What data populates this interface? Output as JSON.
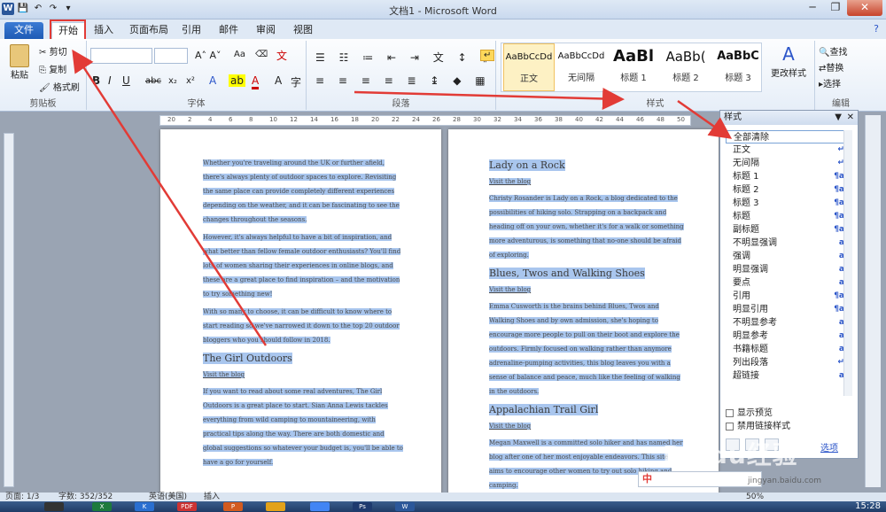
{
  "window": {
    "title": "文档1 - Microsoft Word",
    "qat_icons": [
      "word-logo",
      "save-icon",
      "undo-icon",
      "redo-icon",
      "customize-icon"
    ]
  },
  "tabs": [
    "文件",
    "开始",
    "插入",
    "页面布局",
    "引用",
    "邮件",
    "审阅",
    "视图"
  ],
  "active_tab": "开始",
  "ribbon": {
    "clipboard": {
      "label": "剪贴板",
      "paste": "粘贴",
      "cut": "剪切",
      "copy": "复制",
      "format_painter": "格式刷"
    },
    "font": {
      "label": "字体",
      "buttons": [
        "B",
        "I",
        "U",
        "abc",
        "x₂",
        "x²",
        "A",
        "Aa"
      ]
    },
    "paragraph": {
      "label": "段落"
    },
    "styles": {
      "label": "样式",
      "items": [
        {
          "preview": "AaBbCcDd",
          "name": "正文"
        },
        {
          "preview": "AaBbCcDd",
          "name": "无间隔"
        },
        {
          "preview": "AaBl",
          "name": "标题 1"
        },
        {
          "preview": "AaBb(",
          "name": "标题 2"
        },
        {
          "preview": "AaBbC",
          "name": "标题 3"
        }
      ],
      "change_styles": "更改样式"
    },
    "editing": {
      "label": "编辑",
      "find": "查找",
      "replace": "替换",
      "select": "选择"
    }
  },
  "ruler": {
    "ticks": [
      "20",
      "2",
      "4",
      "6",
      "8",
      "10",
      "12",
      "14",
      "16",
      "18",
      "20",
      "22",
      "24",
      "26",
      "28",
      "30",
      "32",
      "34",
      "36",
      "38",
      "40",
      "42",
      "44",
      "46",
      "48",
      "50"
    ]
  },
  "page1": {
    "paragraphs": [
      "Whether you're traveling around the UK or further afield, there's always plenty of outdoor spaces to explore. Revisiting the same place can provide completely different experiences depending on the weather, and it can be fascinating to see the changes throughout the seasons.",
      "However, it's always helpful to have a bit of inspiration, and what better than fellow female outdoor enthusiasts? You'll find lots of women sharing their experiences in online blogs, and these are a great place to find inspiration – and the motivation to try something new!",
      "With so many to choose, it can be difficult to know where to start reading so we've narrowed it down to the top 20 outdoor bloggers who you should follow in 2018."
    ],
    "heading": "The Girl Outdoors",
    "link": "Visit the blog",
    "para_after": "If you want to read about some real adventures, The Girl Outdoors is a great place to start. Sian Anna Lewis tackles everything from wild camping to mountaineering, with practical tips along the way. There are both domestic and global suggestions so whatever your budget is, you'll be able to have a go for yourself."
  },
  "page2": {
    "sections": [
      {
        "heading": "Lady on a Rock",
        "link": "Visit the blog",
        "text": "Christy Rosander is Lady on a Rock, a blog dedicated to the possibilities of hiking solo. Strapping on a backpack and heading off on your own, whether it's for a walk or something more adventurous, is something that no-one should be afraid of exploring."
      },
      {
        "heading": "Blues, Twos and Walking Shoes",
        "link": "Visit the blog",
        "text": "Emma Cusworth is the brains behind Blues, Twos and Walking Shoes and by own admission, she's hoping to encourage more people to pull on their boot and explore the outdoors. Firmly focused on walking rather than anymore adrenaline-pumping activities, this blog leaves you with a sense of balance and peace, much like the feeling of walking in the outdoors."
      },
      {
        "heading": "Appalachian Trail Girl",
        "link": "Visit the blog",
        "text": "Megan Maxwell is a committed solo hiker and has named her blog after one of her most enjoyable endeavors. This site aims to encourage other women to try out solo hiking and camping."
      }
    ]
  },
  "styles_pane": {
    "title": "样式",
    "items": [
      {
        "name": "全部清除",
        "mark": ""
      },
      {
        "name": "正文",
        "mark": "↵"
      },
      {
        "name": "无间隔",
        "mark": "↵"
      },
      {
        "name": "标题 1",
        "mark": "¶a"
      },
      {
        "name": "标题 2",
        "mark": "¶a"
      },
      {
        "name": "标题 3",
        "mark": "¶a"
      },
      {
        "name": "标题",
        "mark": "¶a"
      },
      {
        "name": "副标题",
        "mark": "¶a"
      },
      {
        "name": "不明显强调",
        "mark": "a"
      },
      {
        "name": "强调",
        "mark": "a"
      },
      {
        "name": "明显强调",
        "mark": "a"
      },
      {
        "name": "要点",
        "mark": "a"
      },
      {
        "name": "引用",
        "mark": "¶a"
      },
      {
        "name": "明显引用",
        "mark": "¶a"
      },
      {
        "name": "不明显参考",
        "mark": "a"
      },
      {
        "name": "明显参考",
        "mark": "a"
      },
      {
        "name": "书籍标题",
        "mark": "a"
      },
      {
        "name": "列出段落",
        "mark": "↵"
      },
      {
        "name": "超链接",
        "mark": "a"
      }
    ],
    "show_preview": "显示预览",
    "disable_linked": "禁用链接样式",
    "options_link": "选项"
  },
  "statusbar": {
    "page": "页面: 1/3",
    "words": "字数: 352/352",
    "language": "英语(美国)",
    "mode": "插入",
    "zoom": "50%"
  },
  "taskbar": {
    "clock": "15:28"
  },
  "watermark": {
    "text": "Baidu经验",
    "sub": "jingyan.baidu.com"
  },
  "ime": {
    "text": "中"
  }
}
